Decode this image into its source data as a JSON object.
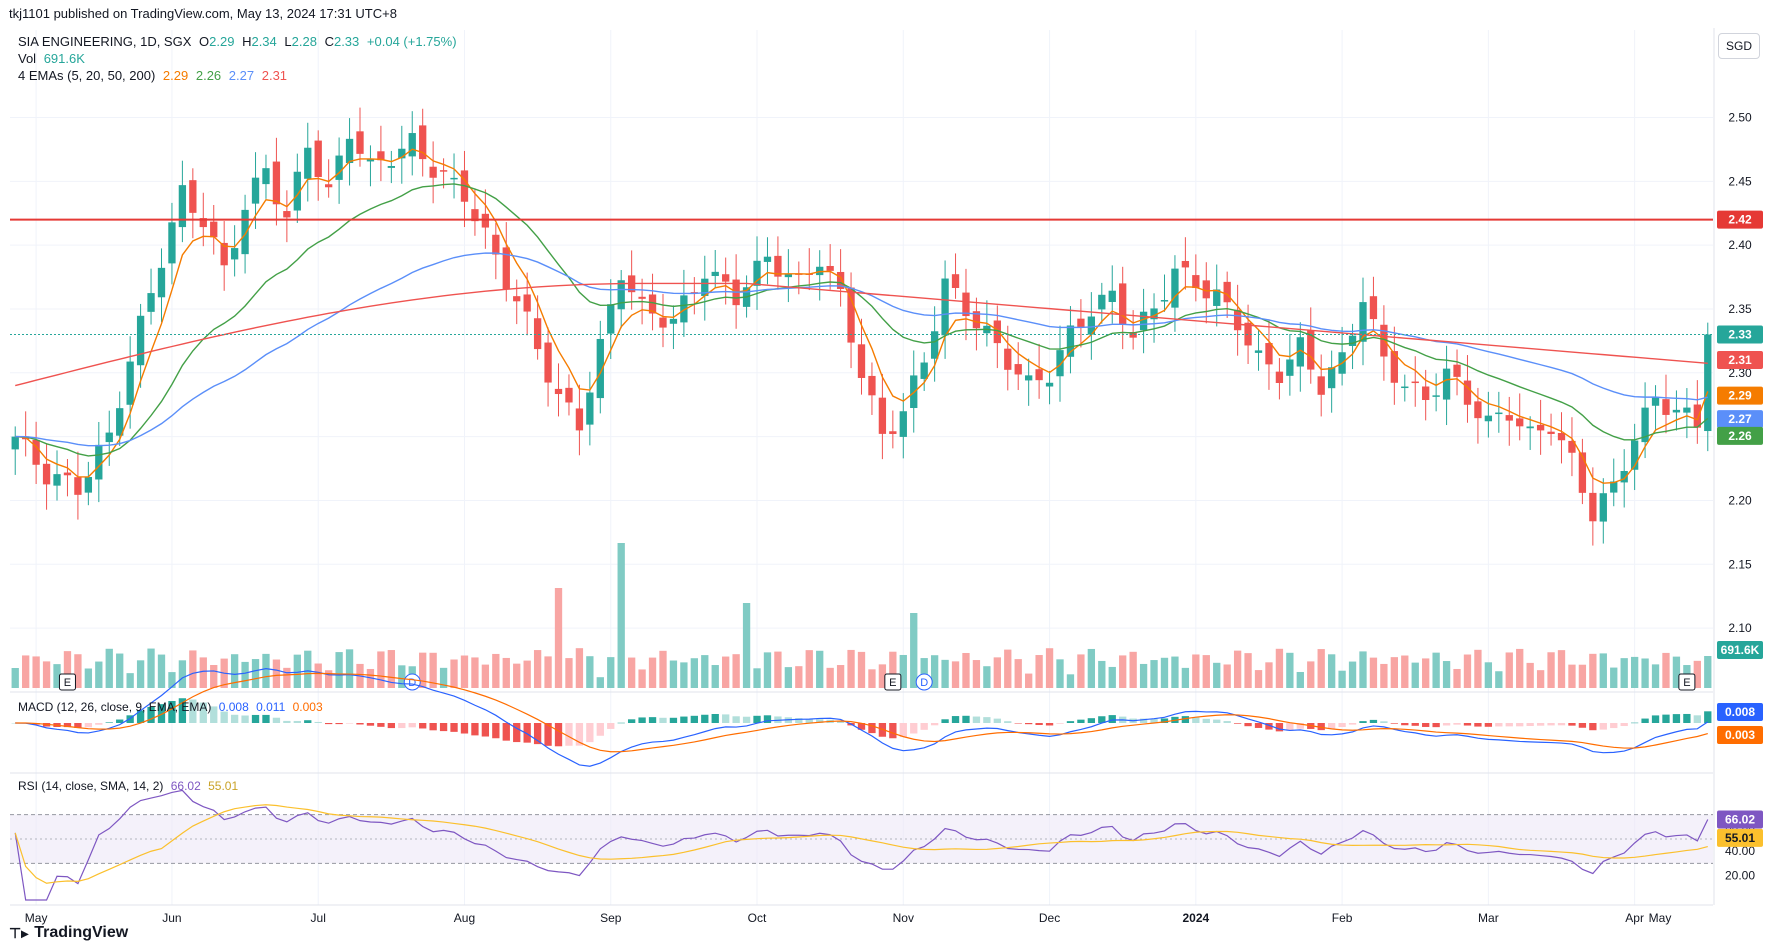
{
  "header": {
    "published": "tkj1101 published on TradingView.com, May 13, 2024 17:31 UTC+8",
    "symbol_line": "SIA ENGINEERING, 1D, SGX",
    "ohlc": {
      "o_label": "O",
      "o": "2.29",
      "h_label": "H",
      "h": "2.34",
      "l_label": "L",
      "l": "2.28",
      "c_label": "C",
      "c": "2.33",
      "change": "+0.04 (+1.75%)"
    },
    "vol_label": "Vol",
    "vol_value": "691.6K",
    "ema_label": "4 EMAs (5, 20, 50, 200)",
    "ema_values": [
      "2.29",
      "2.26",
      "2.27",
      "2.31"
    ],
    "currency": "SGD"
  },
  "colors": {
    "up": "#26a69a",
    "down": "#ef5350",
    "ema5": "#f57c00",
    "ema20": "#43a047",
    "ema50": "#5b8ff9",
    "ema200": "#ef5350",
    "hline": "#e53935",
    "macd": "#2962ff",
    "signal": "#ff6d00",
    "rsi": "#7e57c2",
    "rsi_ma": "#fbc02d",
    "vol_up": "#80cbc4",
    "vol_down": "#f8a5a3"
  },
  "chart_data": {
    "type": "candlestick",
    "y_axis_ticks": [
      "2.50",
      "2.45",
      "2.40",
      "2.35",
      "2.30",
      "2.25",
      "2.20",
      "2.15",
      "2.10"
    ],
    "ylim": [
      2.075,
      2.52
    ],
    "x_axis_labels": [
      "May",
      "Jun",
      "Jul",
      "Aug",
      "Sep",
      "Oct",
      "Nov",
      "Dec",
      "2024",
      "Feb",
      "Mar",
      "Apr",
      "May"
    ],
    "horizontal_line": {
      "value": 2.42,
      "label": "2.42"
    },
    "price_labels": [
      {
        "value": "2.33",
        "color": "#26a69a"
      },
      {
        "value": "2.31",
        "color": "#ef5350"
      },
      {
        "value": "2.29",
        "color": "#f57c00"
      },
      {
        "value": "2.27",
        "color": "#5b8ff9"
      },
      {
        "value": "2.26",
        "color": "#43a047"
      }
    ],
    "close_anchors": [
      [
        0,
        2.25
      ],
      [
        3,
        2.22
      ],
      [
        6,
        2.21
      ],
      [
        9,
        2.25
      ],
      [
        11,
        2.31
      ],
      [
        14,
        2.39
      ],
      [
        16,
        2.44
      ],
      [
        18,
        2.42
      ],
      [
        20,
        2.38
      ],
      [
        22,
        2.43
      ],
      [
        24,
        2.46
      ],
      [
        26,
        2.42
      ],
      [
        28,
        2.48
      ],
      [
        30,
        2.44
      ],
      [
        32,
        2.49
      ],
      [
        34,
        2.46
      ],
      [
        36,
        2.47
      ],
      [
        38,
        2.48
      ],
      [
        40,
        2.46
      ],
      [
        43,
        2.44
      ],
      [
        46,
        2.39
      ],
      [
        49,
        2.34
      ],
      [
        52,
        2.28
      ],
      [
        54,
        2.26
      ],
      [
        56,
        2.32
      ],
      [
        58,
        2.38
      ],
      [
        60,
        2.35
      ],
      [
        63,
        2.34
      ],
      [
        66,
        2.38
      ],
      [
        69,
        2.36
      ],
      [
        72,
        2.39
      ],
      [
        75,
        2.37
      ],
      [
        77,
        2.39
      ],
      [
        79,
        2.36
      ],
      [
        81,
        2.3
      ],
      [
        83,
        2.25
      ],
      [
        85,
        2.27
      ],
      [
        87,
        2.31
      ],
      [
        89,
        2.37
      ],
      [
        91,
        2.35
      ],
      [
        93,
        2.33
      ],
      [
        95,
        2.31
      ],
      [
        97,
        2.29
      ],
      [
        99,
        2.3
      ],
      [
        101,
        2.33
      ],
      [
        103,
        2.35
      ],
      [
        105,
        2.36
      ],
      [
        107,
        2.33
      ],
      [
        109,
        2.35
      ],
      [
        111,
        2.38
      ],
      [
        113,
        2.37
      ],
      [
        115,
        2.36
      ],
      [
        117,
        2.34
      ],
      [
        119,
        2.31
      ],
      [
        121,
        2.3
      ],
      [
        123,
        2.32
      ],
      [
        125,
        2.29
      ],
      [
        127,
        2.31
      ],
      [
        129,
        2.36
      ],
      [
        131,
        2.31
      ],
      [
        133,
        2.29
      ],
      [
        135,
        2.28
      ],
      [
        137,
        2.3
      ],
      [
        139,
        2.28
      ],
      [
        141,
        2.26
      ],
      [
        143,
        2.27
      ],
      [
        145,
        2.25
      ],
      [
        147,
        2.26
      ],
      [
        149,
        2.23
      ],
      [
        151,
        2.19
      ],
      [
        153,
        2.21
      ],
      [
        155,
        2.25
      ],
      [
        157,
        2.28
      ],
      [
        159,
        2.27
      ],
      [
        161,
        2.26
      ],
      [
        162,
        2.33
      ]
    ],
    "volume": {
      "last_value": "691.6K"
    },
    "events": [
      {
        "type": "E",
        "index": 5
      },
      {
        "type": "D",
        "index": 38
      },
      {
        "type": "E",
        "index": 84
      },
      {
        "type": "D",
        "index": 87
      },
      {
        "type": "E",
        "index": 160
      }
    ],
    "macd": {
      "label": "MACD (12, 26, close, 9, EMA, EMA)",
      "values": [
        "0.008",
        "0.011",
        "0.003"
      ]
    },
    "rsi": {
      "label": "RSI (14, close, SMA, 14, 2)",
      "values": [
        "66.02",
        "55.01"
      ],
      "ticks": [
        "60.00",
        "40.00",
        "20.00"
      ]
    }
  },
  "footer": {
    "brand": "TradingView"
  }
}
